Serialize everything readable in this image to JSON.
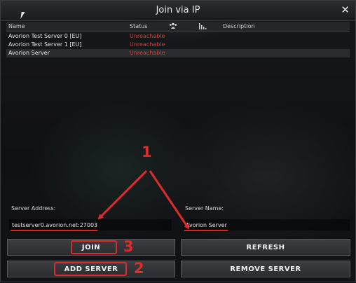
{
  "window": {
    "title": "Join via IP",
    "close_glyph": "✕"
  },
  "table": {
    "columns": {
      "name": "Name",
      "status": "Status",
      "description": "Description",
      "ping_icon": "signal-bars-icon",
      "players_icon": "players-icon"
    },
    "rows": [
      {
        "name": "Avorion Test Server 0 [EU]",
        "status": "Unreachable"
      },
      {
        "name": "Avorion Test Server 1 [EU]",
        "status": "Unreachable"
      },
      {
        "name": "Avorion Server",
        "status": "Unreachable"
      }
    ]
  },
  "form": {
    "address_label": "Server Address:",
    "address_value": "testserver0.avorion.net:27003",
    "name_label": "Server Name:",
    "name_value": "Avorion Server"
  },
  "buttons": {
    "join": "JOIN",
    "refresh": "REFRESH",
    "add_server": "ADD SERVER",
    "remove_server": "REMOVE SERVER"
  },
  "annotations": {
    "n1": "1",
    "n2": "2",
    "n3": "3",
    "color": "#e02b2b"
  },
  "colors": {
    "unreachable": "#e23a3a"
  }
}
